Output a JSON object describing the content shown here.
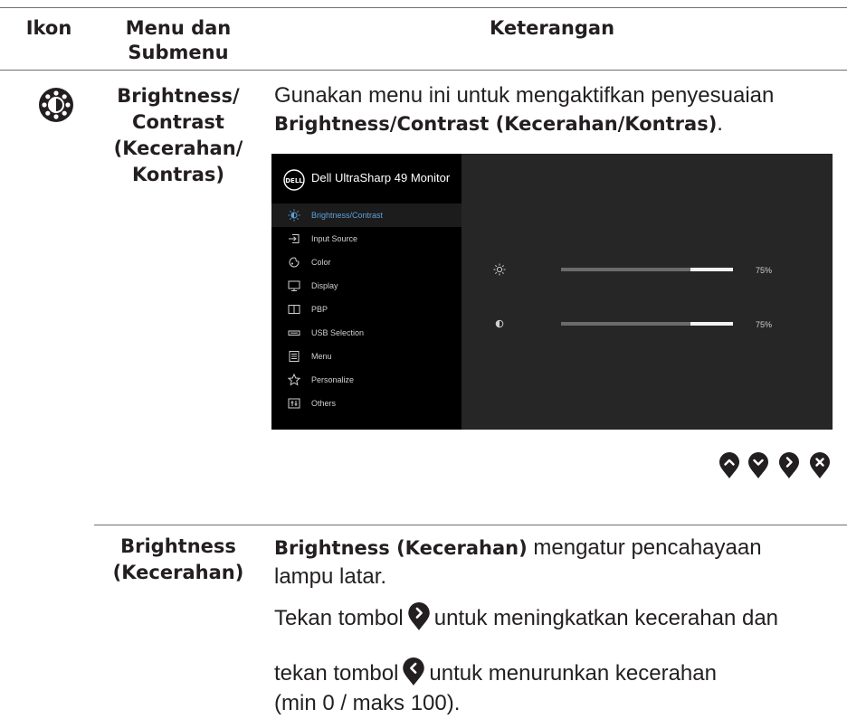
{
  "table_header": {
    "col_icon": "Ikon",
    "col_menu": "Menu dan Submenu",
    "col_desc": "Keterangan"
  },
  "row1": {
    "menu_name_line1": "Brightness/",
    "menu_name_line2": "Contrast",
    "menu_name_line3": "(Kecerahan/",
    "menu_name_line4": "Kontras)",
    "desc_line1": "Gunakan menu ini untuk mengaktifkan penyesuaian",
    "desc_bold": "Brightness/Contrast (Kecerahan/Kontras)",
    "desc_period": "."
  },
  "osd": {
    "logo_text": "DELL",
    "title": "Dell UltraSharp 49 Monitor",
    "menu_items": [
      {
        "label": "Brightness/Contrast",
        "icon": "brightness-icon",
        "active": true
      },
      {
        "label": "Input Source",
        "icon": "input-source-icon",
        "active": false
      },
      {
        "label": "Color",
        "icon": "color-icon",
        "active": false
      },
      {
        "label": "Display",
        "icon": "display-icon",
        "active": false
      },
      {
        "label": "PBP",
        "icon": "pbp-icon",
        "active": false
      },
      {
        "label": "USB Selection",
        "icon": "usb-icon",
        "active": false
      },
      {
        "label": "Menu",
        "icon": "menu-icon",
        "active": false
      },
      {
        "label": "Personalize",
        "icon": "star-icon",
        "active": false
      },
      {
        "label": "Others",
        "icon": "others-icon",
        "active": false
      }
    ],
    "brightness": {
      "icon": "sun-icon",
      "value": 75,
      "label": "75%"
    },
    "contrast": {
      "icon": "contrast-icon",
      "value": 75,
      "label": "75%"
    },
    "accent_color": "#5ea0d8"
  },
  "nav_buttons": [
    "up-button",
    "down-button",
    "right-button",
    "close-button"
  ],
  "row2": {
    "menu_name_line1": "Brightness",
    "menu_name_line2": "(Kecerahan)",
    "p1_bold": "Brightness (Kecerahan)",
    "p1_rest": " mengatur pencahayaan",
    "p1_line2": "lampu latar.",
    "p2_a": "Tekan tombol",
    "p2_b": "untuk meningkatkan kecerahan dan",
    "p3_a": "tekan tombol",
    "p3_b": "untuk menurunkan kecerahan",
    "p4": "(min 0 / maks 100)."
  }
}
